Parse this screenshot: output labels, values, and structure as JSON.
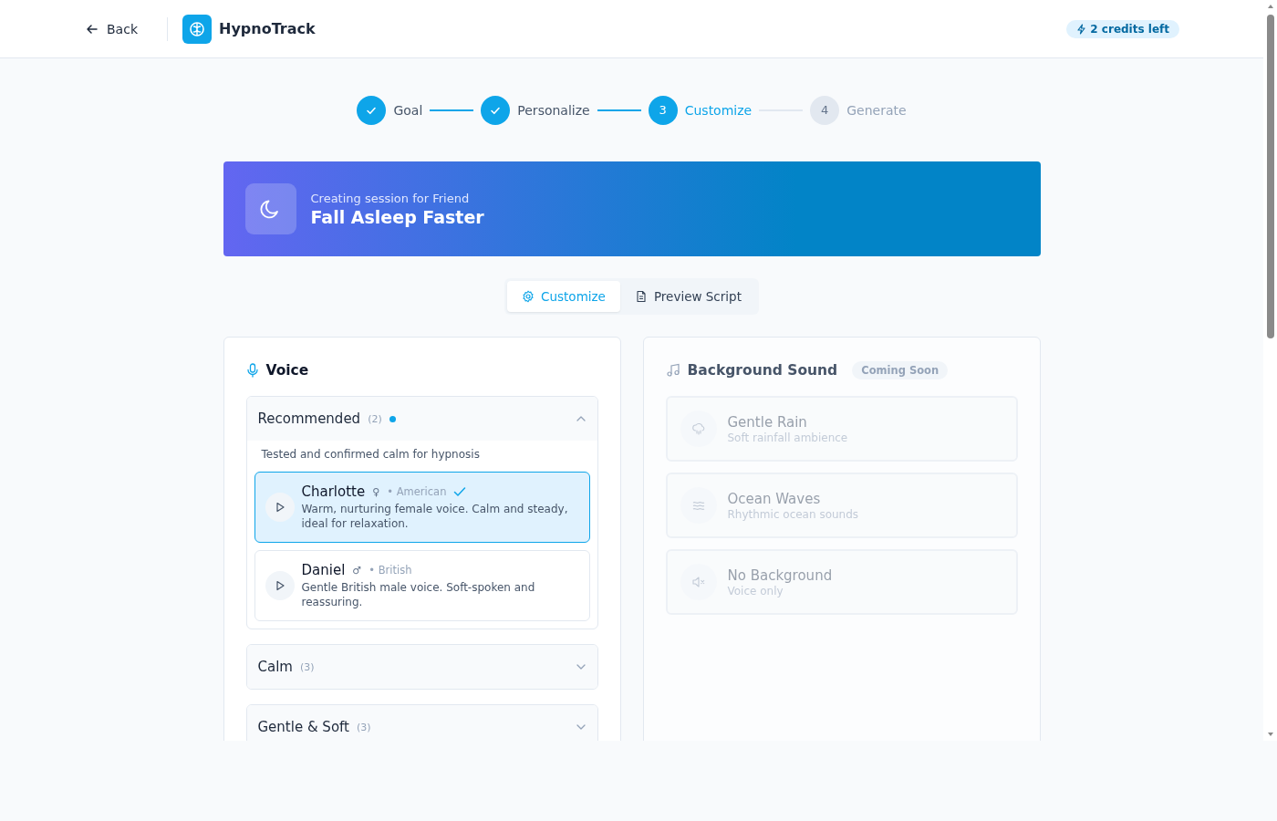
{
  "header": {
    "back": "Back",
    "brand": "HypnoTrack",
    "credits": "2 credits left"
  },
  "steps": [
    {
      "label": "Goal",
      "done": true,
      "current": false
    },
    {
      "label": "Personalize",
      "done": true,
      "current": false
    },
    {
      "label": "Customize",
      "marker": "3",
      "done": false,
      "current": true
    },
    {
      "label": "Generate",
      "marker": "4",
      "done": false,
      "current": false
    }
  ],
  "banner": {
    "subtitle": "Creating session for Friend",
    "title": "Fall Asleep Faster"
  },
  "tabs": [
    {
      "label": "Customize",
      "selected": true,
      "kind": "gear"
    },
    {
      "label": "Preview Script",
      "selected": false,
      "kind": "document"
    }
  ],
  "voice": {
    "title": "Voice",
    "groups": [
      {
        "name": "Recommended",
        "count": "(2)",
        "featured": true,
        "expanded": true,
        "description": "Tested and confirmed calm for hypnosis",
        "voices": [
          {
            "name": "Charlotte",
            "gender": "♀",
            "accent": "• American",
            "description": "Warm, nurturing female voice. Calm and steady, ideal for relaxation.",
            "selected": true
          },
          {
            "name": "Daniel",
            "gender": "♂",
            "accent": "• British",
            "description": "Gentle British male voice. Soft-spoken and reassuring.",
            "selected": false
          }
        ]
      },
      {
        "name": "Calm",
        "count": "(3)",
        "featured": false,
        "expanded": false
      },
      {
        "name": "Gentle & Soft",
        "count": "(3)",
        "featured": false,
        "expanded": false
      }
    ]
  },
  "background": {
    "title": "Background Sound",
    "badge": "Coming Soon",
    "options": [
      {
        "name": "Gentle Rain",
        "description": "Soft rainfall ambience",
        "kind": "rain",
        "disabled": true
      },
      {
        "name": "Ocean Waves",
        "description": "Rhythmic ocean sounds",
        "kind": "waves",
        "disabled": true
      },
      {
        "name": "No Background",
        "description": "Voice only",
        "kind": "mute",
        "disabled": true
      }
    ]
  }
}
